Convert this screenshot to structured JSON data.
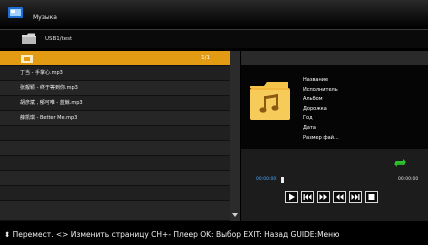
{
  "header": {
    "title": "Музыка",
    "icon": "music-app-icon"
  },
  "path": {
    "text": "USB1/test",
    "icon": "folder-icon"
  },
  "list": {
    "page_indicator": "1/1",
    "items": [
      {
        "label": "丁当 - 手掌心.mp3"
      },
      {
        "label": "张靓颖 - 终于等到你.mp3"
      },
      {
        "label": "胡彦斌 , 郁可唯 - 蓝鲸.mp3"
      },
      {
        "label": "薛凯琪 - Better Me.mp3"
      }
    ]
  },
  "info": {
    "fields": [
      "Название",
      "Исполнитель",
      "Альбом",
      "Дорожка",
      "Год",
      "Дата",
      "Размер фай..."
    ]
  },
  "player": {
    "time_elapsed": "00:00:00",
    "time_total": "00:00:00",
    "progress": 0
  },
  "footer": {
    "hint": "Перемест. <> Изменить страницу  CH+- Плеер  OK: Выбор    EXIT: Назад  GUIDE:Меню"
  },
  "colors": {
    "selection": "#e49b14",
    "accent_green": "#2ec42e",
    "time_blue": "#4aa8ff"
  }
}
